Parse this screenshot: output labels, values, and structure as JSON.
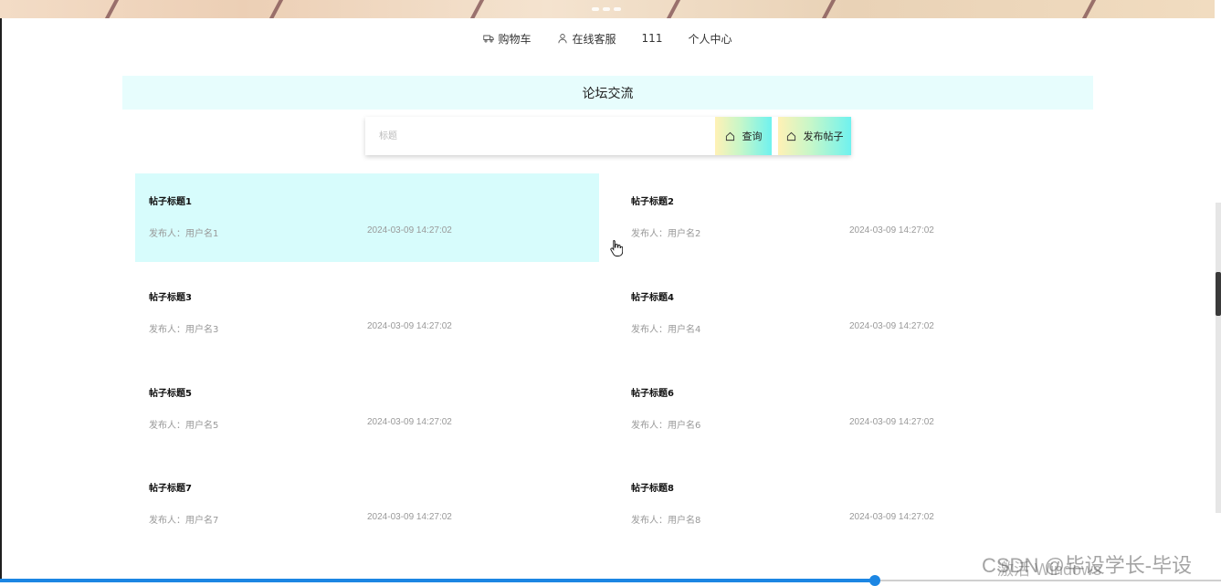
{
  "topnav": {
    "items": [
      {
        "label": "购物车",
        "icon": "cart-icon"
      },
      {
        "label": "在线客服",
        "icon": "user-icon"
      },
      {
        "label": "111"
      },
      {
        "label": "个人中心"
      }
    ]
  },
  "page": {
    "title": "论坛交流"
  },
  "search": {
    "placeholder": "标题",
    "value": "",
    "search_label": "查询",
    "publish_label": "发布帖子",
    "button_icon": "home-icon"
  },
  "posts": [
    {
      "title": "帖子标题1",
      "author": "发布人：用户名1",
      "time": "2024-03-09 14:27:02"
    },
    {
      "title": "帖子标题2",
      "author": "发布人：用户名2",
      "time": "2024-03-09 14:27:02"
    },
    {
      "title": "帖子标题3",
      "author": "发布人：用户名3",
      "time": "2024-03-09 14:27:02"
    },
    {
      "title": "帖子标题4",
      "author": "发布人：用户名4",
      "time": "2024-03-09 14:27:02"
    },
    {
      "title": "帖子标题5",
      "author": "发布人：用户名5",
      "time": "2024-03-09 14:27:02"
    },
    {
      "title": "帖子标题6",
      "author": "发布人：用户名6",
      "time": "2024-03-09 14:27:02"
    },
    {
      "title": "帖子标题7",
      "author": "发布人：用户名7",
      "time": "2024-03-09 14:27:02"
    },
    {
      "title": "帖子标题8",
      "author": "发布人：用户名8",
      "time": "2024-03-09 14:27:02"
    }
  ],
  "watermarks": {
    "activate": "激活 Windows",
    "csdn": "CSDN @毕设学长-毕设"
  },
  "colors": {
    "title_bar_bg": "#e7fdfd",
    "active_post_bg": "#d7fcfc",
    "button_gradient_start": "#fff1b5",
    "button_gradient_end": "#6ff2ef",
    "progress_blue": "#1c86e3"
  }
}
